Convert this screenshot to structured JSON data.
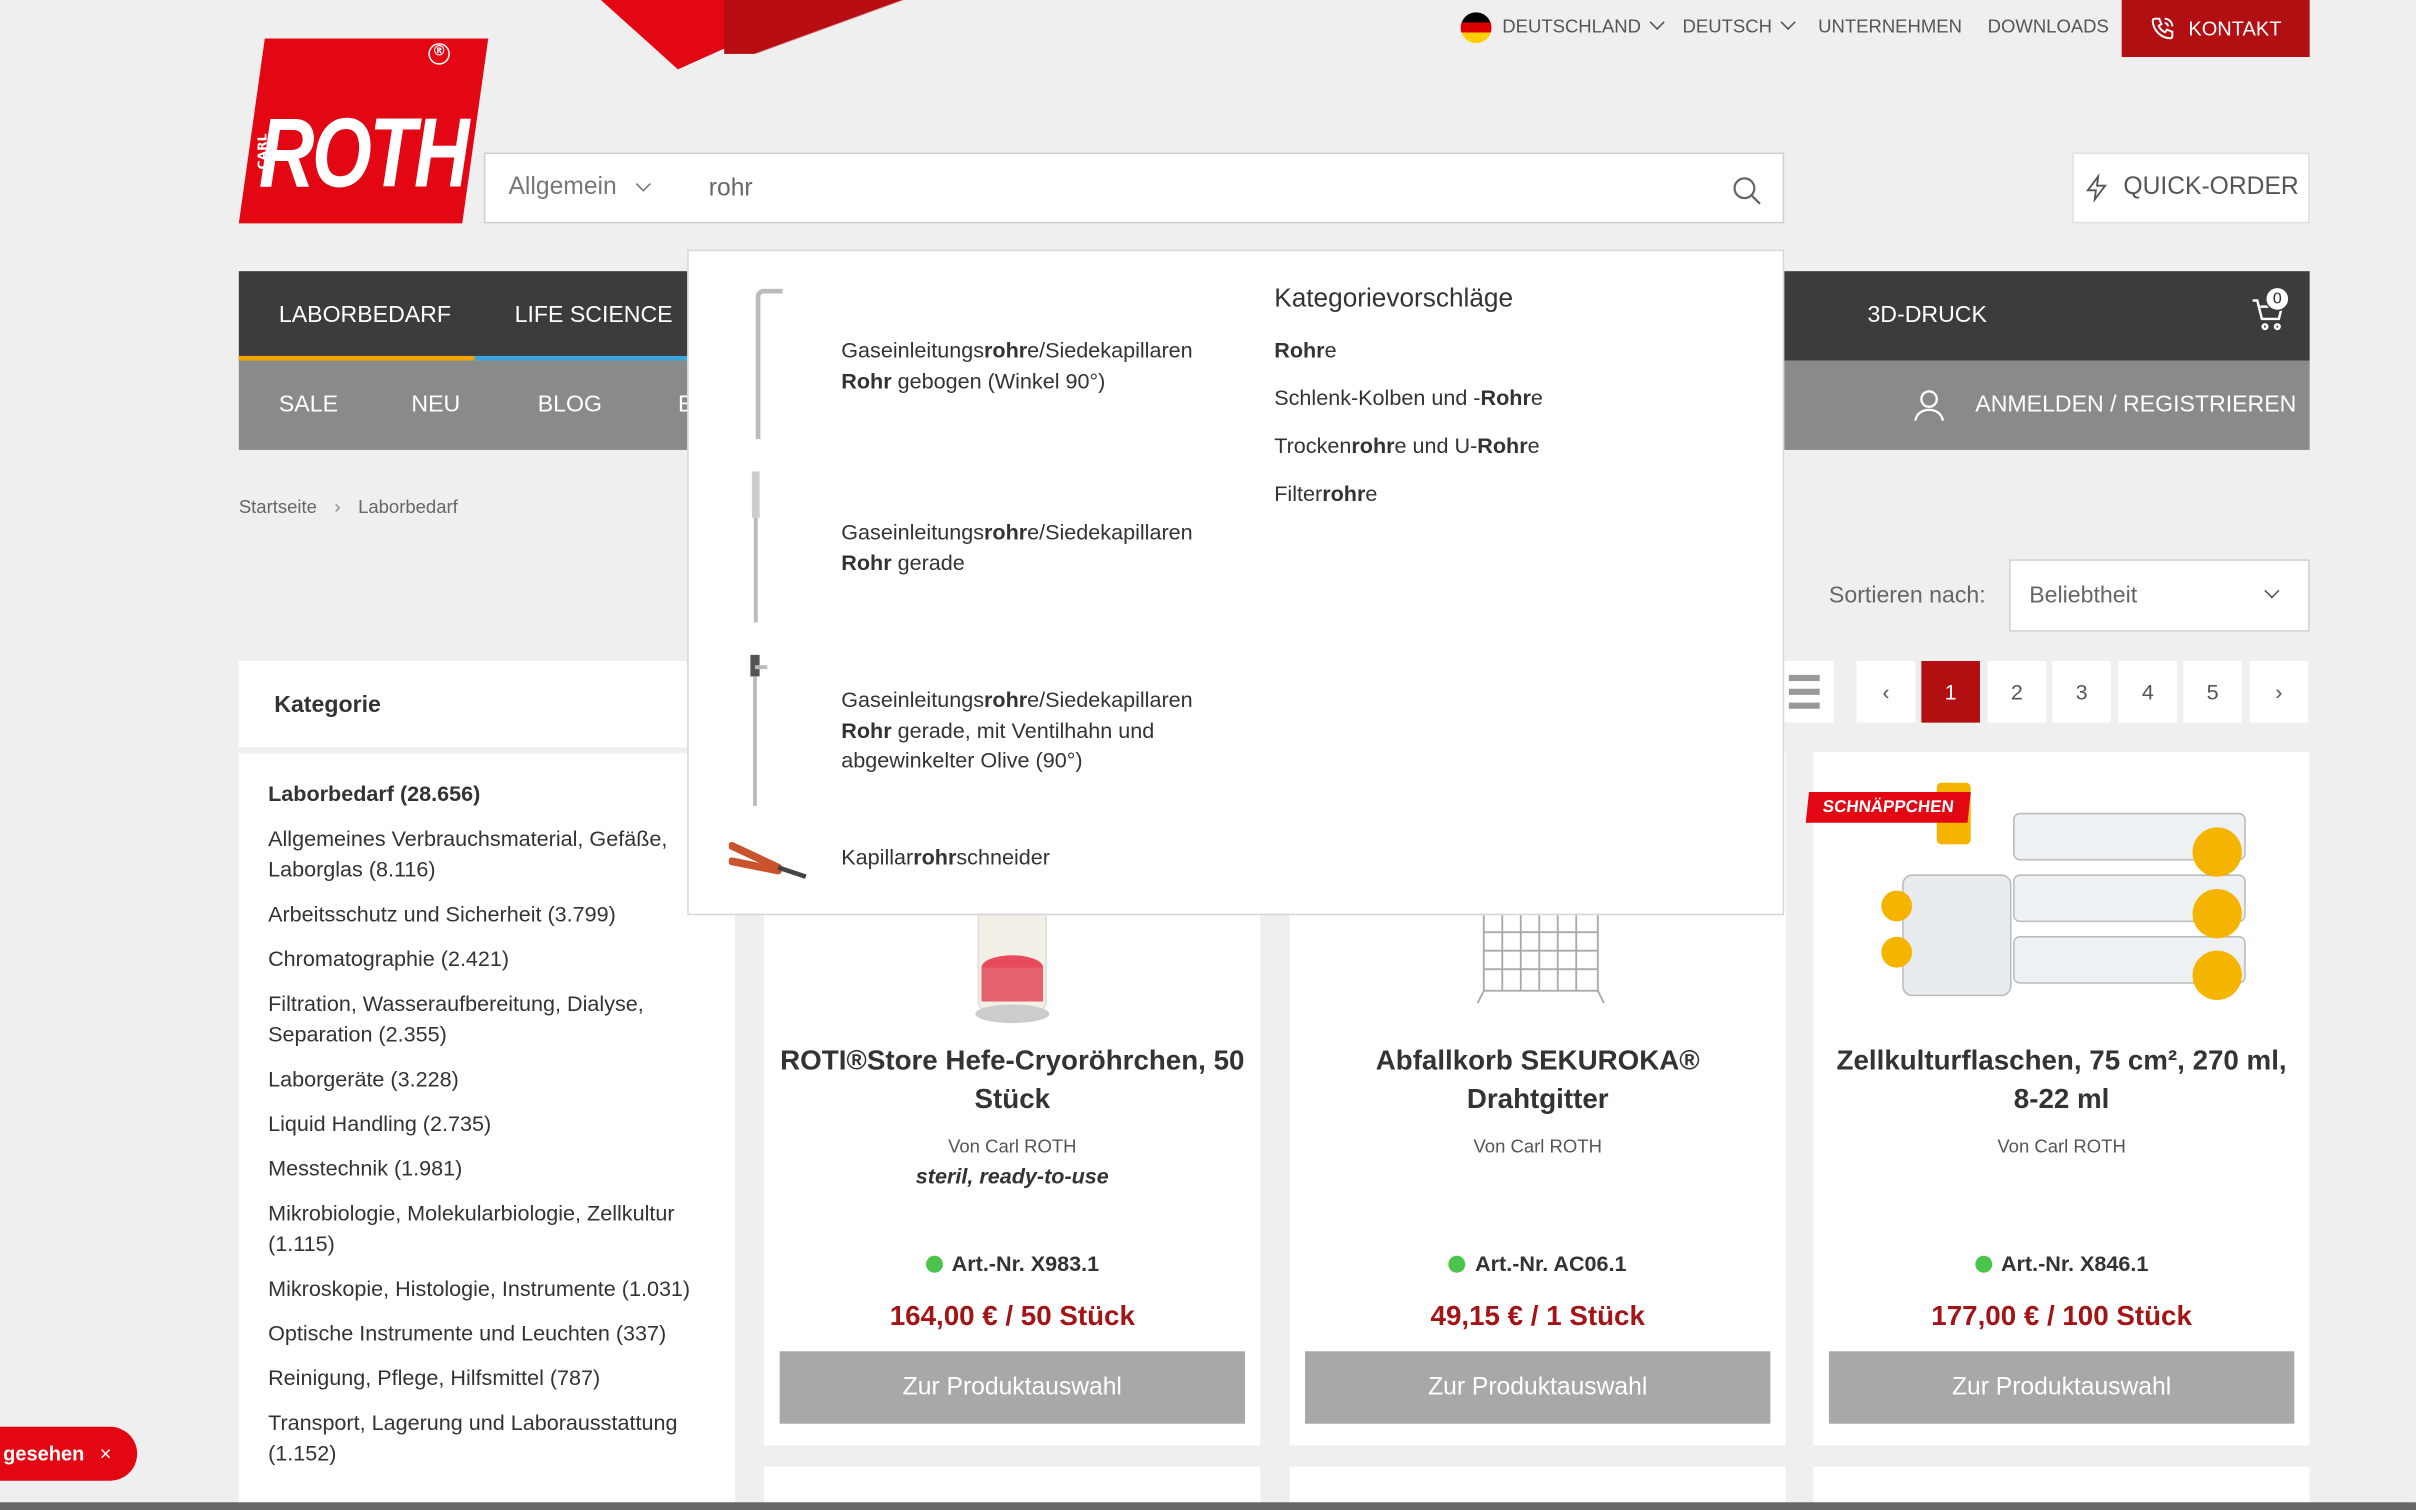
{
  "topbar": {
    "country": "DEUTSCHLAND",
    "language": "DEUTSCH",
    "company": "UNTERNEHMEN",
    "downloads": "DOWNLOADS",
    "contact": "KONTAKT"
  },
  "logo": {
    "text": "ROTH",
    "small": "CARL",
    "reg": "®"
  },
  "search": {
    "scope": "Allgemein",
    "value": "rohr"
  },
  "quick_order": "QUICK-ORDER",
  "main_nav": {
    "items": [
      "LABORBEDARF",
      "LIFE SCIENCE",
      "3D-DRUCK"
    ],
    "cart_count": "0"
  },
  "sub_nav": {
    "items": [
      "SALE",
      "NEU",
      "BLOG",
      "E"
    ],
    "login": "ANMELDEN / REGISTRIEREN"
  },
  "breadcrumb": {
    "home": "Startseite",
    "current": "Laborbedarf"
  },
  "sort": {
    "label": "Sortieren nach:",
    "value": "Beliebtheit"
  },
  "pagination": {
    "prev": "‹",
    "pages": [
      "1",
      "2",
      "3",
      "4",
      "5"
    ],
    "next": "›",
    "active": "1"
  },
  "sidebar": {
    "heading": "Kategorie",
    "categories": [
      "Laborbedarf  (28.656)",
      "Allgemeines Verbrauchsmaterial, Gefäße, Laborglas (8.116)",
      "Arbeitsschutz und Sicherheit (3.799)",
      "Chromatographie (2.421)",
      "Filtration, Wasseraufbereitung, Dialyse, Separation (2.355)",
      "Laborgeräte (3.228)",
      "Liquid Handling (2.735)",
      "Messtechnik (1.981)",
      "Mikrobiologie, Molekularbiologie, Zellkultur (1.115)",
      "Mikroskopie, Histologie, Instrumente (1.031)",
      "Optische Instrumente und Leuchten (337)",
      "Reinigung, Pflege, Hilfsmittel (787)",
      "Transport, Lagerung und Laborausstattung (1.152)"
    ]
  },
  "products": [
    {
      "title": "ROTI®Store Hefe-Cryoröhrchen, 50 Stück",
      "by": "Von Carl ROTH",
      "sub": "steril, ready-to-use",
      "art": "Art.-Nr. X983.1",
      "price": "164,00 €  / 50 Stück",
      "button": "Zur Produktauswahl"
    },
    {
      "title": "Abfallkorb SEKUROKA® Drahtgitter",
      "by": "Von Carl ROTH",
      "sub": "",
      "art": "Art.-Nr. AC06.1",
      "price": "49,15 €  / 1 Stück",
      "button": "Zur Produktauswahl"
    },
    {
      "title": "Zellkulturflaschen, 75 cm², 270 ml, 8-22 ml",
      "by": "Von Carl ROTH",
      "sub": "",
      "art": "Art.-Nr. X846.1",
      "price": "177,00 €  / 100 Stück",
      "button": "Zur Produktauswahl",
      "badge": "SCHNÄPPCHEN"
    }
  ],
  "dropdown": {
    "suggestions": [
      {
        "l1_pre": "Gaseinleitungs",
        "l1_bold": "rohr",
        "l1_post": "e/Siedekapillaren",
        "l2_bold": "Rohr",
        "l2_post": " gebogen (Winkel 90°)"
      },
      {
        "l1_pre": "Gaseinleitungs",
        "l1_bold": "rohr",
        "l1_post": "e/Siedekapillaren",
        "l2_bold": "Rohr",
        "l2_post": " gerade"
      },
      {
        "l1_pre": "Gaseinleitungs",
        "l1_bold": "rohr",
        "l1_post": "e/Siedekapillaren",
        "l2_bold": "Rohr",
        "l2_post": " gerade, mit Ventilhahn und",
        "l3": "abgewinkelter Olive (90°)"
      },
      {
        "l1_pre": "Kapillar",
        "l1_bold": "rohr",
        "l1_post": "schneider"
      }
    ],
    "category_heading": "Kategorievorschläge",
    "categories": [
      {
        "pre": "",
        "bold": "Rohr",
        "post": "e"
      },
      {
        "pre": "Schlenk-Kolben und -",
        "bold": "Rohr",
        "post": "e"
      },
      {
        "pre": "Trocken",
        "bold": "rohr",
        "post": "e und U-",
        "bold2": "Rohr",
        "post2": "e"
      },
      {
        "pre": "Filter",
        "bold": "rohr",
        "post": "e"
      }
    ]
  },
  "recently_viewed": {
    "label": "gesehen",
    "close": "×"
  },
  "colors": {
    "brand_red": "#e30613",
    "dark_red": "#b20f12",
    "nav_dark": "#3d3c3c",
    "nav_grey": "#8a8a8a",
    "price_red": "#a31417"
  }
}
